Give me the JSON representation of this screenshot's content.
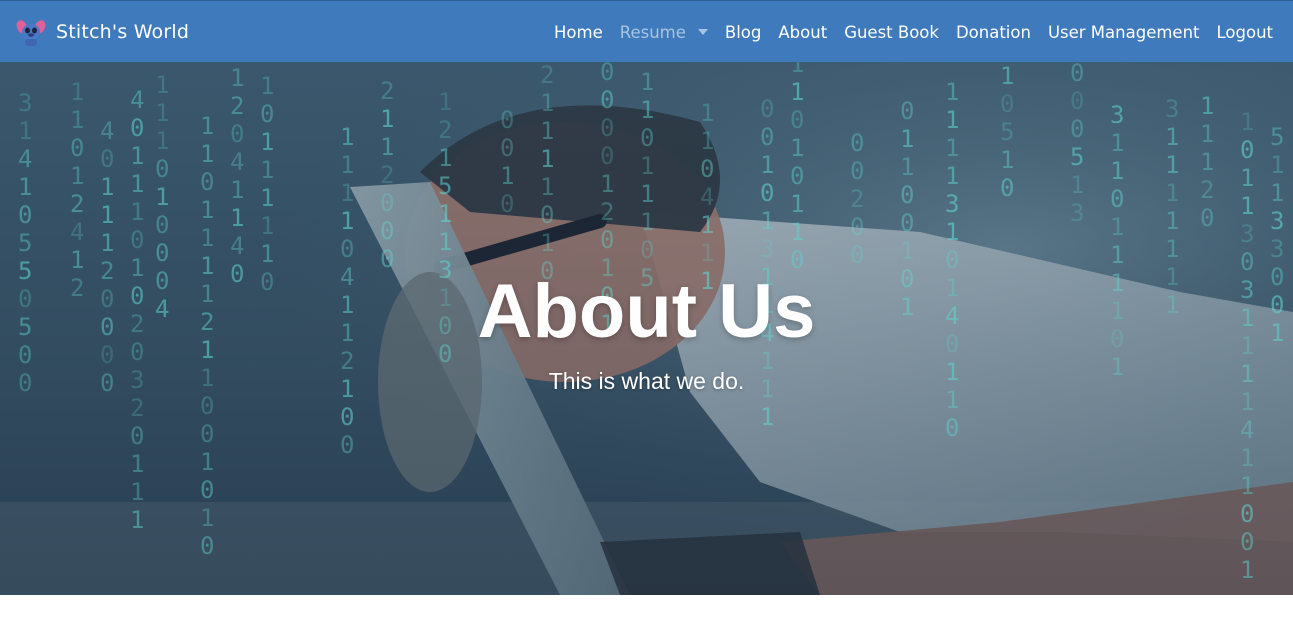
{
  "brand": {
    "name": "Stitch's World",
    "logo_icon": "stitch-logo-icon"
  },
  "nav": {
    "items": [
      {
        "label": "Home",
        "muted": false
      },
      {
        "label": "Resume",
        "muted": true,
        "dropdown": true
      },
      {
        "label": "Blog",
        "muted": false
      },
      {
        "label": "About",
        "muted": false
      },
      {
        "label": "Guest Book",
        "muted": false
      },
      {
        "label": "Donation",
        "muted": false
      },
      {
        "label": "User Management",
        "muted": false
      },
      {
        "label": "Logout",
        "muted": false
      }
    ]
  },
  "hero": {
    "title": "About Us",
    "subtitle": "This is what we do.",
    "image_description": "man-peering-into-laptop-with-binary-rain"
  },
  "colors": {
    "navbar": "#3f7bbc",
    "nav_muted": "#a9c3e2",
    "matrix_green": "#5fd6d0"
  }
}
